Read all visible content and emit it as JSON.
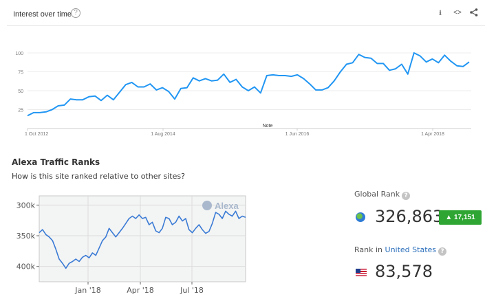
{
  "trends": {
    "title": "Interest over time",
    "help_icon": "?",
    "tools": {
      "download": "⭳",
      "embed": "<>",
      "share": "share-icon"
    },
    "chart_data": {
      "type": "line",
      "title": "",
      "y_ticks": [
        100,
        75,
        50,
        25
      ],
      "ylim": [
        0,
        110
      ],
      "x_tick_labels": [
        "1 Oct 2012",
        "1 Aug 2014",
        "1 Jun 2016",
        "1 Apr 2018"
      ],
      "note_label": "Note",
      "color": "#2196f3",
      "series": [
        {
          "values": [
            17,
            21,
            21,
            22,
            25,
            30,
            31,
            39,
            38,
            38,
            42,
            43,
            37,
            44,
            38,
            48,
            58,
            61,
            55,
            55,
            59,
            51,
            54,
            49,
            39,
            53,
            54,
            67,
            63,
            66,
            63,
            64,
            72,
            61,
            65,
            55,
            50,
            55,
            47,
            70,
            71,
            70,
            70,
            69,
            71,
            66,
            59,
            51,
            51,
            54,
            63,
            75,
            85,
            87,
            98,
            94,
            93,
            86,
            86,
            77,
            79,
            85,
            72,
            100,
            96,
            88,
            92,
            87,
            97,
            89,
            83,
            82,
            88
          ]
        }
      ]
    }
  },
  "alexa": {
    "title": "Alexa Traffic Ranks",
    "subtitle": "How is this site ranked relative to other sites?",
    "watermark": "Alexa",
    "chart_data": {
      "type": "line",
      "y_tick_labels": [
        "300k",
        "350k",
        "400k"
      ],
      "y_ticks": [
        300000,
        350000,
        400000
      ],
      "ylim": [
        285000,
        425000
      ],
      "y_inverted": true,
      "x_tick_labels": [
        "Jan '18",
        "Apr '18",
        "Jul '18"
      ],
      "color": "#3a7bd5",
      "series": [
        {
          "values": [
            345000,
            340000,
            348000,
            352000,
            358000,
            372000,
            388000,
            395000,
            403000,
            395000,
            392000,
            388000,
            392000,
            385000,
            382000,
            386000,
            378000,
            382000,
            370000,
            358000,
            352000,
            338000,
            345000,
            352000,
            345000,
            338000,
            330000,
            322000,
            318000,
            322000,
            316000,
            322000,
            320000,
            332000,
            328000,
            342000,
            345000,
            338000,
            320000,
            322000,
            332000,
            328000,
            318000,
            326000,
            322000,
            340000,
            345000,
            338000,
            332000,
            340000,
            346000,
            343000,
            330000,
            312000,
            315000,
            322000,
            310000,
            315000,
            318000,
            310000,
            322000,
            318000,
            320000
          ]
        }
      ]
    },
    "global_rank": {
      "label": "Global Rank",
      "value": "326,863",
      "delta": "17,151",
      "delta_arrow": "▲"
    },
    "country_rank": {
      "label_prefix": "Rank in",
      "country": "United States",
      "value": "83,578"
    }
  }
}
